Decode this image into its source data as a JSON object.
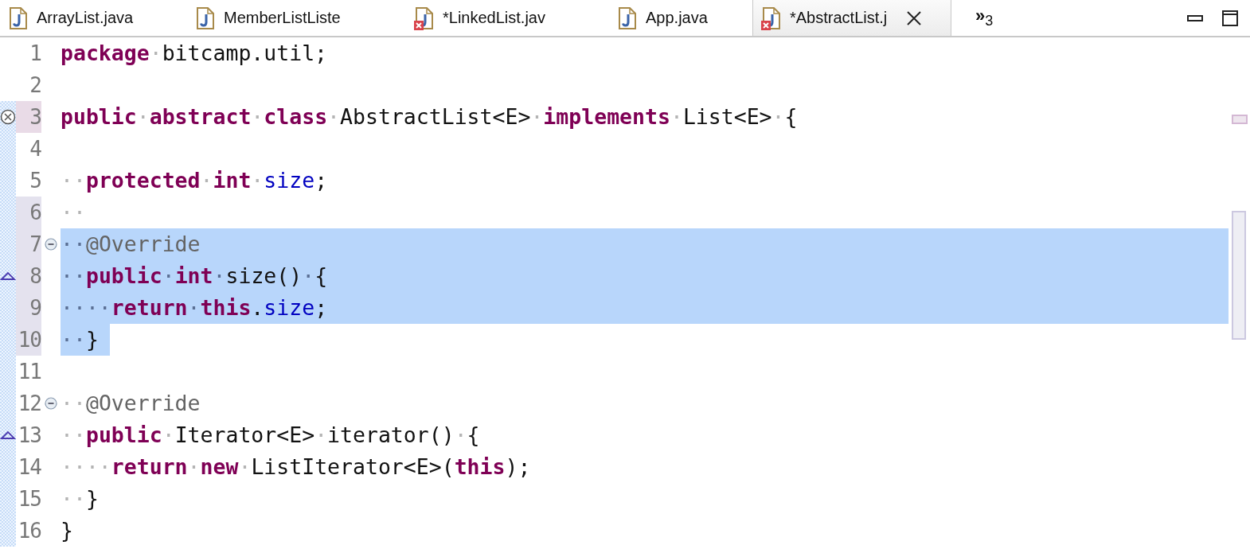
{
  "tabs": [
    {
      "label": "ArrayList.java",
      "selected": false,
      "error": false,
      "closable": false
    },
    {
      "label": "MemberListListe",
      "selected": false,
      "error": false,
      "closable": false
    },
    {
      "label": "*LinkedList.jav",
      "selected": false,
      "error": true,
      "closable": false
    },
    {
      "label": "App.java",
      "selected": false,
      "error": false,
      "closable": false
    },
    {
      "label": "*AbstractList.j",
      "selected": true,
      "error": true,
      "closable": true
    }
  ],
  "overflow": "»$_{3}$",
  "lines": [
    {
      "number": "1",
      "selected": false,
      "added": false,
      "error": false,
      "changed": false,
      "overrides": false,
      "fold": false,
      "tokens": [
        {
          "kind": "kw",
          "text": "package"
        },
        {
          "kind": "ws",
          "text": "·"
        },
        {
          "kind": "plain",
          "text": "bitcamp.util;"
        }
      ]
    },
    {
      "number": "2",
      "added": false,
      "error": false,
      "changed": false,
      "overrides": false,
      "fold": false
    },
    {
      "number": "3",
      "selected": false,
      "added": true,
      "error": true,
      "overrides": false,
      "fold": false,
      "tokens": [
        {
          "kind": "kw",
          "text": "public"
        },
        {
          "kind": "ws",
          "text": "·"
        },
        {
          "kind": "kw",
          "text": "abstract"
        },
        {
          "kind": "ws",
          "text": "·"
        },
        {
          "kind": "kw",
          "text": "class"
        },
        {
          "kind": "ws",
          "text": "·"
        },
        {
          "kind": "plain",
          "text": "AbstractList<E>"
        },
        {
          "kind": "ws",
          "text": "·"
        },
        {
          "kind": "kw",
          "text": "implements"
        },
        {
          "kind": "ws",
          "text": "·"
        },
        {
          "kind": "plain",
          "text": "List<E>"
        },
        {
          "kind": "ws",
          "text": "·"
        },
        {
          "kind": "plain",
          "text": "{"
        }
      ]
    },
    {
      "number": "4",
      "added": true,
      "error": false,
      "changed": false,
      "overrides": false,
      "fold": false
    },
    {
      "number": "5",
      "selected": false,
      "added": true,
      "error": false,
      "changed": false,
      "overrides": false,
      "fold": false,
      "tokens": [
        {
          "kind": "ws",
          "text": "··"
        },
        {
          "kind": "kw",
          "text": "protected"
        },
        {
          "kind": "ws",
          "text": "·"
        },
        {
          "kind": "kw",
          "text": "int"
        },
        {
          "kind": "ws",
          "text": "·"
        },
        {
          "kind": "field",
          "text": "size"
        },
        {
          "kind": "plain",
          "text": ";"
        }
      ]
    },
    {
      "number": "6",
      "selected": false,
      "added": true,
      "error": false,
      "changed": true,
      "overrides": false,
      "fold": false,
      "tokens": [
        {
          "kind": "ws",
          "text": "··"
        }
      ]
    },
    {
      "number": "7",
      "selected": true,
      "added": true,
      "error": false,
      "changed": true,
      "overrides": false,
      "fold": true,
      "tokens": [
        {
          "kind": "ws",
          "text": "··"
        },
        {
          "kind": "annotation",
          "text": "@Override"
        }
      ]
    },
    {
      "number": "8",
      "selected": true,
      "added": true,
      "error": false,
      "changed": true,
      "overrides": true,
      "fold": false,
      "tokens": [
        {
          "kind": "ws",
          "text": "··"
        },
        {
          "kind": "kw",
          "text": "public"
        },
        {
          "kind": "ws",
          "text": "·"
        },
        {
          "kind": "kw",
          "text": "int"
        },
        {
          "kind": "ws",
          "text": "·"
        },
        {
          "kind": "plain",
          "text": "size()"
        },
        {
          "kind": "ws",
          "text": "·"
        },
        {
          "kind": "plain",
          "text": "{"
        }
      ]
    },
    {
      "number": "9",
      "selected": true,
      "added": true,
      "error": false,
      "changed": true,
      "overrides": false,
      "fold": false,
      "tokens": [
        {
          "kind": "ws",
          "text": "····"
        },
        {
          "kind": "kw",
          "text": "return"
        },
        {
          "kind": "ws",
          "text": "·"
        },
        {
          "kind": "kw",
          "text": "this"
        },
        {
          "kind": "plain",
          "text": "."
        },
        {
          "kind": "field",
          "text": "size"
        },
        {
          "kind": "plain",
          "text": ";"
        }
      ]
    },
    {
      "number": "10",
      "selected": true,
      "added": true,
      "error": false,
      "changed": true,
      "overrides": false,
      "fold": false,
      "tokens": [
        {
          "kind": "ws",
          "text": "··"
        },
        {
          "kind": "plain",
          "text": "}"
        }
      ]
    },
    {
      "number": "11",
      "added": true,
      "error": false,
      "changed": false,
      "overrides": false,
      "fold": false
    },
    {
      "number": "12",
      "selected": false,
      "added": true,
      "error": false,
      "changed": false,
      "overrides": false,
      "fold": true,
      "tokens": [
        {
          "kind": "ws",
          "text": "··"
        },
        {
          "kind": "annotation",
          "text": "@Override"
        }
      ]
    },
    {
      "number": "13",
      "selected": false,
      "added": true,
      "error": false,
      "changed": false,
      "overrides": true,
      "fold": false,
      "tokens": [
        {
          "kind": "ws",
          "text": "··"
        },
        {
          "kind": "kw",
          "text": "public"
        },
        {
          "kind": "ws",
          "text": "·"
        },
        {
          "kind": "plain",
          "text": "Iterator<E>"
        },
        {
          "kind": "ws",
          "text": "·"
        },
        {
          "kind": "plain",
          "text": "iterator()"
        },
        {
          "kind": "ws",
          "text": "·"
        },
        {
          "kind": "plain",
          "text": "{"
        }
      ]
    },
    {
      "number": "14",
      "selected": false,
      "added": true,
      "error": false,
      "changed": false,
      "overrides": false,
      "fold": false,
      "tokens": [
        {
          "kind": "ws",
          "text": "····"
        },
        {
          "kind": "kw",
          "text": "return"
        },
        {
          "kind": "ws",
          "text": "·"
        },
        {
          "kind": "kw",
          "text": "new"
        },
        {
          "kind": "ws",
          "text": "·"
        },
        {
          "kind": "plain",
          "text": "ListIterator<E>("
        },
        {
          "kind": "kw",
          "text": "this"
        },
        {
          "kind": "plain",
          "text": ");"
        }
      ]
    },
    {
      "number": "15",
      "selected": false,
      "added": true,
      "error": false,
      "changed": false,
      "overrides": false,
      "fold": false,
      "tokens": [
        {
          "kind": "ws",
          "text": "··"
        },
        {
          "kind": "plain",
          "text": "}"
        }
      ]
    },
    {
      "number": "16",
      "selected": false,
      "added": true,
      "error": false,
      "changed": false,
      "overrides": false,
      "fold": false,
      "tokens": [
        {
          "kind": "plain",
          "text": "}"
        }
      ]
    }
  ]
}
